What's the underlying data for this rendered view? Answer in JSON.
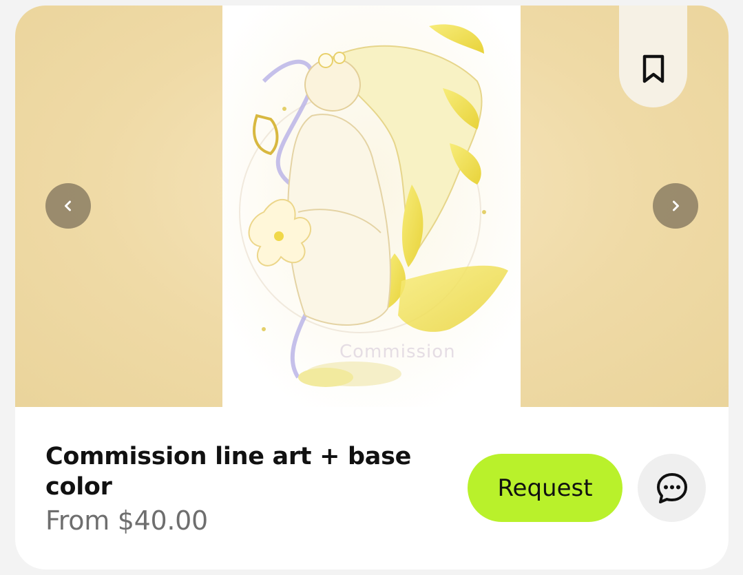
{
  "listing": {
    "title": "Commission line art + base color",
    "price": "From $40.00",
    "request_label": "Request",
    "image_watermark": "Commission"
  },
  "icons": {
    "bookmark": "bookmark-icon",
    "prev": "chevron-left-icon",
    "next": "chevron-right-icon",
    "chat": "chat-bubble-icon"
  },
  "colors": {
    "accent": "#b9f12b",
    "media_background": "#efdaa6",
    "nav_button": "#877a60",
    "title": "#111111",
    "price": "#6e6e6e"
  }
}
